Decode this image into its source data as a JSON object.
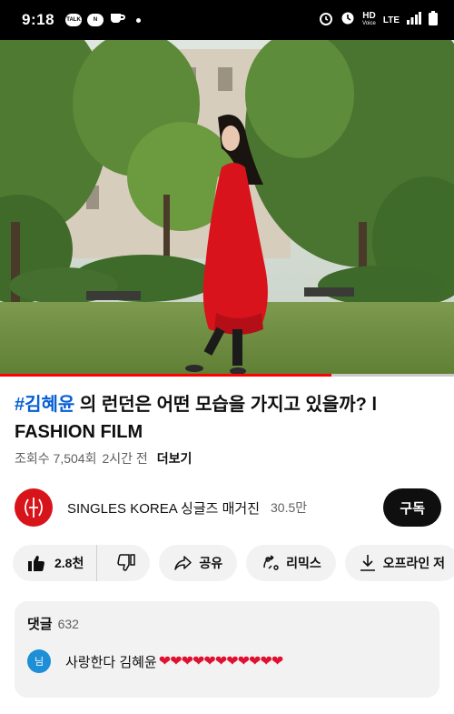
{
  "status_bar": {
    "time": "9:18",
    "left_icons": [
      "talk-icon",
      "news-icon",
      "cup-icon",
      "dot-icon"
    ],
    "hd": "HD",
    "hd_sub": "Voice",
    "lte": "LTE",
    "right_icons": [
      "alarm-icon",
      "hd-voice-icon",
      "lte-icon",
      "signal-icon",
      "battery-icon"
    ]
  },
  "video": {
    "progress": 0.73,
    "accent": "#ff0000"
  },
  "title": {
    "hashtag": "#김혜윤",
    "text": " 의 런던은 어떤 모습을 가지고 있을까? l FASHION FILM"
  },
  "meta": {
    "views": "조회수 7,504회",
    "time_ago": "2시간 전",
    "more": "더보기"
  },
  "channel": {
    "name": "SINGLES KOREA 싱글즈 매거진",
    "subscribers": "30.5만",
    "subscribe_label": "구독",
    "avatar_color": "#d8141b"
  },
  "actions": {
    "like_count": "2.8천",
    "share_label": "공유",
    "remix_label": "리믹스",
    "offline_label": "오프라인 저"
  },
  "comments": {
    "label": "댓글",
    "count": "632",
    "first": {
      "avatar_letter": "님",
      "text": "사랑한다 김혜윤",
      "hearts": "❤❤❤❤❤❤❤❤❤❤❤"
    }
  }
}
